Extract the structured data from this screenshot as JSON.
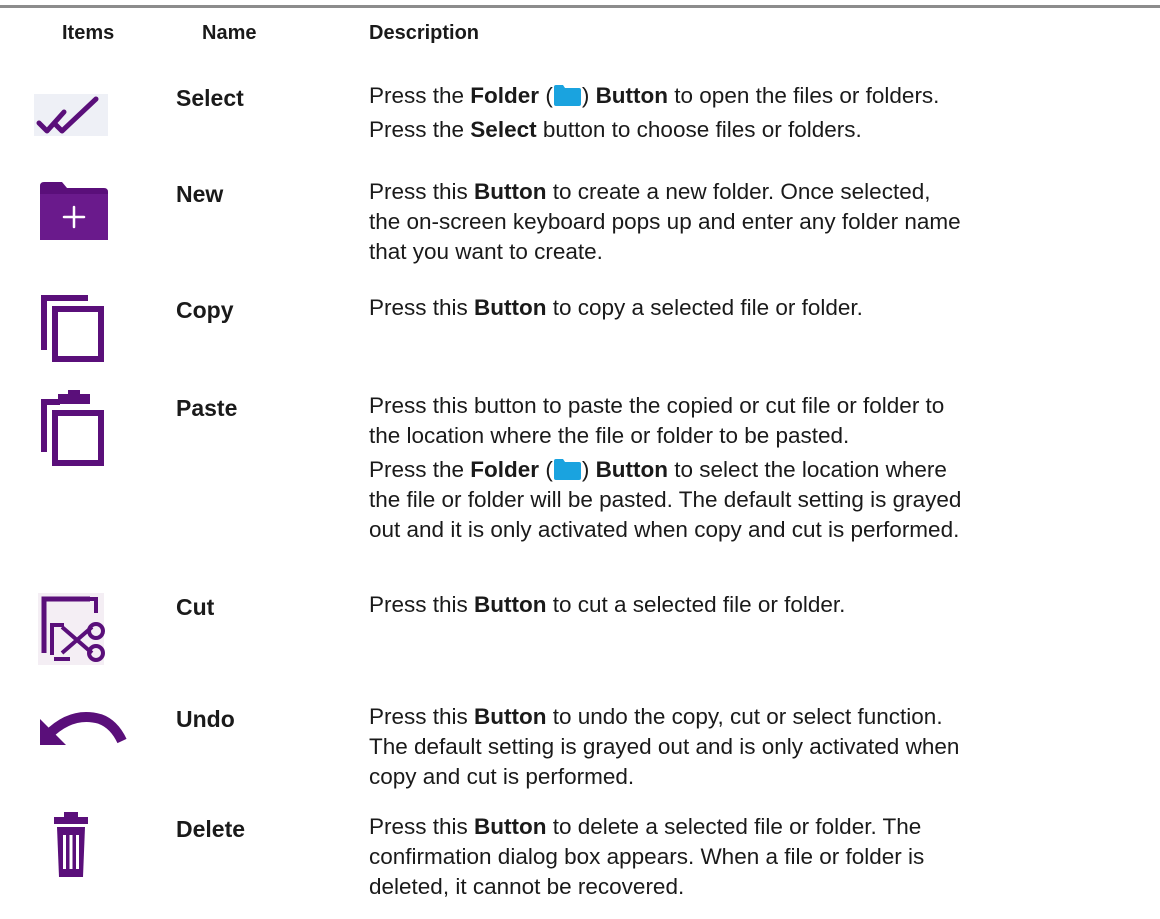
{
  "headers": {
    "items": "Items",
    "name": "Name",
    "description": "Description"
  },
  "colors": {
    "icon_purple": "#5a0f7a",
    "folder_blue": "#1aa3df",
    "rule_gray": "#8c8c8c"
  },
  "rows": [
    {
      "icon": "double-check-icon",
      "name": "Select",
      "lines": [
        [
          "Press the ",
          "Folder",
          " (",
          "[folder-icon]",
          ") ",
          "Button",
          " to open the files or folders."
        ],
        [
          "Press the ",
          "Select",
          " button to choose files or folders."
        ]
      ]
    },
    {
      "icon": "new-folder-icon",
      "name": "New",
      "lines": [
        [
          "Press this ",
          "Button",
          " to create a new folder. Once selected,"
        ],
        [
          "the on-screen keyboard pops up and enter any folder name"
        ],
        [
          "that you want to create."
        ]
      ]
    },
    {
      "icon": "copy-icon",
      "name": "Copy",
      "lines": [
        [
          "Press this ",
          "Button",
          " to copy a selected file or folder."
        ]
      ]
    },
    {
      "icon": "paste-icon",
      "name": "Paste",
      "lines": [
        [
          "Press this button to paste the copied or cut file or folder to"
        ],
        [
          "the location where the file or folder to be pasted."
        ],
        [
          "Press the ",
          "Folder",
          " (",
          "[folder-icon]",
          ") ",
          "Button",
          " to select the location where"
        ],
        [
          "the file or folder will be pasted. The default setting is grayed"
        ],
        [
          "out and it is only activated when copy and cut is performed."
        ]
      ]
    },
    {
      "icon": "cut-icon",
      "name": "Cut",
      "lines": [
        [
          "Press this ",
          "Button",
          " to cut a selected file or folder."
        ]
      ]
    },
    {
      "icon": "undo-icon",
      "name": "Undo",
      "lines": [
        [
          "Press this ",
          "Button",
          " to undo the copy, cut or select function."
        ],
        [
          "The default setting is grayed out and is only activated when"
        ],
        [
          "copy and cut is performed."
        ]
      ]
    },
    {
      "icon": "trash-icon",
      "name": "Delete",
      "lines": [
        [
          "Press this ",
          "Button",
          " to delete a selected file or folder. The"
        ],
        [
          "confirmation dialog box appears. When a file or folder is"
        ],
        [
          "deleted, it cannot be recovered."
        ]
      ]
    }
  ]
}
